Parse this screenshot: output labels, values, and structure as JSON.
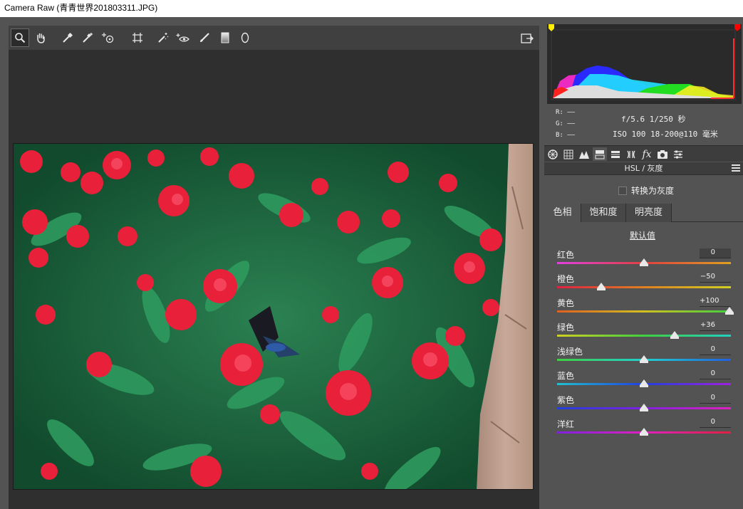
{
  "window": {
    "title": "Camera Raw (青青世界201803311.JPG)"
  },
  "toolbar": {
    "tools": [
      {
        "name": "zoom-tool",
        "glyph": "🔍"
      },
      {
        "name": "hand-tool",
        "glyph": "✋"
      },
      {
        "name": "white-balance-tool",
        "glyph": "⚲"
      },
      {
        "name": "color-sampler-tool",
        "glyph": "✎"
      },
      {
        "name": "target-adjustment-tool",
        "glyph": "⊙"
      },
      {
        "name": "transform-tool",
        "glyph": "⌗"
      },
      {
        "name": "spot-removal-tool",
        "glyph": "✦"
      },
      {
        "name": "red-eye-tool",
        "glyph": "◉"
      },
      {
        "name": "adjustment-brush-tool",
        "glyph": "✐"
      },
      {
        "name": "graduated-filter-tool",
        "glyph": "▮"
      },
      {
        "name": "radial-filter-tool",
        "glyph": "◯"
      }
    ],
    "export_icon": "open-preferences-icon"
  },
  "readout": {
    "r": "R:  ——",
    "g": "G:  ——",
    "b": "B:  ——",
    "exposure": "f/5.6   1/250 秒",
    "lens": "ISO 100   18-200@110 毫米"
  },
  "panel": {
    "title": "HSL / 灰度",
    "convert_gray": "转换为灰度",
    "subtabs": [
      "色相",
      "饱和度",
      "明亮度"
    ],
    "default_link": "默认值",
    "sliders": [
      {
        "label": "红色",
        "value": "0",
        "fraction": 0.5
      },
      {
        "label": "橙色",
        "value": "−50",
        "fraction": 0.25
      },
      {
        "label": "黄色",
        "value": "+100",
        "fraction": 1.0
      },
      {
        "label": "绿色",
        "value": "+36",
        "fraction": 0.68
      },
      {
        "label": "浅绿色",
        "value": "0",
        "fraction": 0.5
      },
      {
        "label": "蓝色",
        "value": "0",
        "fraction": 0.5
      },
      {
        "label": "紫色",
        "value": "0",
        "fraction": 0.5
      },
      {
        "label": "洋红",
        "value": "0",
        "fraction": 0.5
      }
    ]
  },
  "colors": {
    "panel_bg": "#535353",
    "canvas_bg": "#2f2f2f",
    "highlight_clip": "#ff0000",
    "shadow_clip": "#ffff00"
  }
}
